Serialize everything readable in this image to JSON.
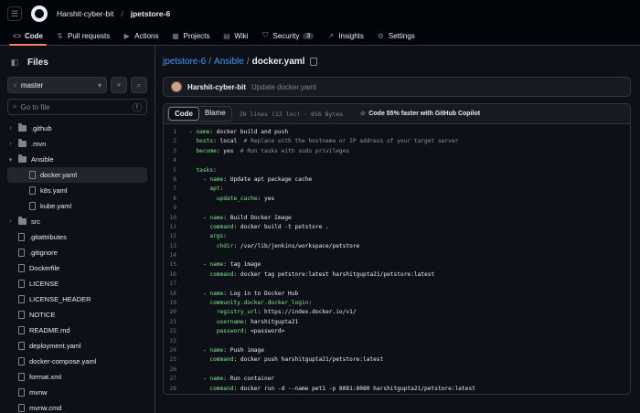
{
  "header": {
    "owner": "Harshit-cyber-bit",
    "separator": "/",
    "repo": "jpetstore-6"
  },
  "tabs": [
    {
      "label": "Code",
      "icon": "code-icon",
      "glyph": "<>",
      "active": true
    },
    {
      "label": "Pull requests",
      "icon": "pull-request-icon",
      "glyph": "⇅"
    },
    {
      "label": "Actions",
      "icon": "play-icon",
      "glyph": "▶"
    },
    {
      "label": "Projects",
      "icon": "table-icon",
      "glyph": "▦"
    },
    {
      "label": "Wiki",
      "icon": "book-icon",
      "glyph": "▤"
    },
    {
      "label": "Security",
      "icon": "shield-icon",
      "glyph": "⛉",
      "counter": "3"
    },
    {
      "label": "Insights",
      "icon": "graph-icon",
      "glyph": "↗"
    },
    {
      "label": "Settings",
      "icon": "gear-icon",
      "glyph": "⚙"
    }
  ],
  "sidebar": {
    "title": "Files",
    "branch": "master",
    "search_placeholder": "Go to file",
    "search_key": "t",
    "items": [
      {
        "name": ".github",
        "type": "folder",
        "depth": 0,
        "expanded": false
      },
      {
        "name": ".mvn",
        "type": "folder",
        "depth": 0,
        "expanded": false
      },
      {
        "name": "Ansible",
        "type": "folder",
        "depth": 0,
        "expanded": true
      },
      {
        "name": "docker.yaml",
        "type": "file",
        "depth": 1,
        "selected": true
      },
      {
        "name": "k8s.yaml",
        "type": "file",
        "depth": 1
      },
      {
        "name": "kube.yaml",
        "type": "file",
        "depth": 1
      },
      {
        "name": "src",
        "type": "folder",
        "depth": 0,
        "expanded": false
      },
      {
        "name": ".gitattributes",
        "type": "file",
        "depth": 0
      },
      {
        "name": ".gitignore",
        "type": "file",
        "depth": 0
      },
      {
        "name": "Dockerfile",
        "type": "file",
        "depth": 0
      },
      {
        "name": "LICENSE",
        "type": "file",
        "depth": 0
      },
      {
        "name": "LICENSE_HEADER",
        "type": "file",
        "depth": 0
      },
      {
        "name": "NOTICE",
        "type": "file",
        "depth": 0
      },
      {
        "name": "README.md",
        "type": "file",
        "depth": 0
      },
      {
        "name": "deployment.yaml",
        "type": "file",
        "depth": 0
      },
      {
        "name": "docker-compose.yaml",
        "type": "file",
        "depth": 0
      },
      {
        "name": "format.xml",
        "type": "file",
        "depth": 0
      },
      {
        "name": "mvnw",
        "type": "file",
        "depth": 0
      },
      {
        "name": "mvnw.cmd",
        "type": "file",
        "depth": 0
      }
    ]
  },
  "content": {
    "path_repo": "jpetstore-6",
    "path_sep": "/",
    "path_folder": "Ansible",
    "path_file": "docker.yaml",
    "commit_author": "Harshit-cyber-bit",
    "commit_message": "Update docker.yaml",
    "view_code": "Code",
    "view_blame": "Blame",
    "file_meta": "28 lines (22 loc) · 856 Bytes",
    "copilot": "Code 55% faster with GitHub Copilot"
  },
  "code_lines": [
    [
      [
        "- ",
        ""
      ],
      [
        "name",
        "k"
      ],
      [
        ": docker build and push",
        ""
      ]
    ],
    [
      [
        "  ",
        ""
      ],
      [
        "hosts",
        "k"
      ],
      [
        ": local  ",
        ""
      ],
      [
        "# Replace with the hostname or IP address of your target server",
        "c"
      ]
    ],
    [
      [
        "  ",
        ""
      ],
      [
        "become",
        "k"
      ],
      [
        ": yes  ",
        ""
      ],
      [
        "# Run tasks with sudo privileges",
        "c"
      ]
    ],
    [
      [
        "",
        ""
      ]
    ],
    [
      [
        "  ",
        ""
      ],
      [
        "tasks",
        "k"
      ],
      [
        ":",
        ""
      ]
    ],
    [
      [
        "    - ",
        ""
      ],
      [
        "name",
        "k"
      ],
      [
        ": Update apt package cache",
        ""
      ]
    ],
    [
      [
        "      ",
        ""
      ],
      [
        "apt",
        "k"
      ],
      [
        ":",
        ""
      ]
    ],
    [
      [
        "        ",
        ""
      ],
      [
        "update_cache",
        "k"
      ],
      [
        ": yes",
        ""
      ]
    ],
    [
      [
        "",
        ""
      ]
    ],
    [
      [
        "    - ",
        ""
      ],
      [
        "name",
        "k"
      ],
      [
        ": Build Docker Image",
        ""
      ]
    ],
    [
      [
        "      ",
        ""
      ],
      [
        "command",
        "k"
      ],
      [
        ": docker build -t petstore .",
        ""
      ]
    ],
    [
      [
        "      ",
        ""
      ],
      [
        "args",
        "k"
      ],
      [
        ":",
        ""
      ]
    ],
    [
      [
        "        ",
        ""
      ],
      [
        "chdir",
        "k"
      ],
      [
        ": /var/lib/jenkins/workspace/petstore",
        ""
      ]
    ],
    [
      [
        "",
        ""
      ]
    ],
    [
      [
        "    - ",
        ""
      ],
      [
        "name",
        "k"
      ],
      [
        ": tag image",
        ""
      ]
    ],
    [
      [
        "      ",
        ""
      ],
      [
        "command",
        "k"
      ],
      [
        ": docker tag petstore:latest harshitgupta21/petstore:latest",
        ""
      ]
    ],
    [
      [
        "",
        ""
      ]
    ],
    [
      [
        "    - ",
        ""
      ],
      [
        "name",
        "k"
      ],
      [
        ": Log in to Docker Hub",
        ""
      ]
    ],
    [
      [
        "      ",
        ""
      ],
      [
        "community.docker.docker_login",
        "k"
      ],
      [
        ":",
        ""
      ]
    ],
    [
      [
        "        ",
        ""
      ],
      [
        "registry_url",
        "k"
      ],
      [
        ": https://index.docker.io/v1/",
        ""
      ]
    ],
    [
      [
        "        ",
        ""
      ],
      [
        "username",
        "k"
      ],
      [
        ": harshitgupta21",
        ""
      ]
    ],
    [
      [
        "        ",
        ""
      ],
      [
        "password",
        "k"
      ],
      [
        ": <password>",
        ""
      ]
    ],
    [
      [
        "",
        ""
      ]
    ],
    [
      [
        "    - ",
        ""
      ],
      [
        "name",
        "k"
      ],
      [
        ": Push image",
        ""
      ]
    ],
    [
      [
        "      ",
        ""
      ],
      [
        "command",
        "k"
      ],
      [
        ": docker push harshitgupta21/petstore:latest",
        ""
      ]
    ],
    [
      [
        "",
        ""
      ]
    ],
    [
      [
        "    - ",
        ""
      ],
      [
        "name",
        "k"
      ],
      [
        ": Run container",
        ""
      ]
    ],
    [
      [
        "      ",
        ""
      ],
      [
        "command",
        "k"
      ],
      [
        ": docker run -d --name pet1 -p 8081:8080 harshitgupta21/petstore:latest",
        ""
      ]
    ]
  ]
}
